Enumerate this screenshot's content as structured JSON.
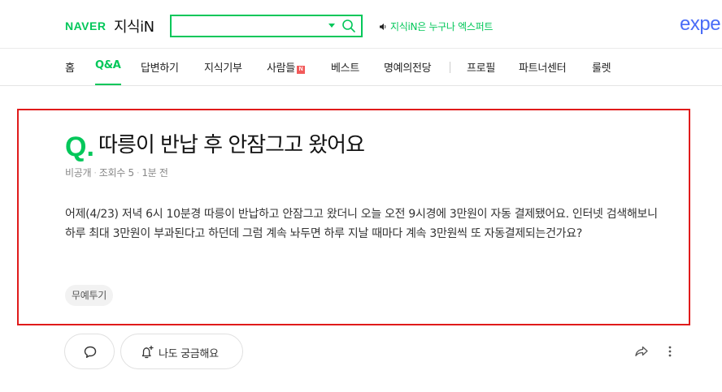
{
  "header": {
    "logo_brand": "NAVER",
    "logo_service": "지식iN",
    "search": {
      "value": "",
      "placeholder": ""
    },
    "notice": "지식iN은 누구나 엑스퍼트",
    "expert_logo": "expe"
  },
  "nav": {
    "items": [
      {
        "label": "홈"
      },
      {
        "label": "Q&A",
        "active": true
      },
      {
        "label": "답변하기"
      },
      {
        "label": "지식기부"
      },
      {
        "label": "사람들",
        "badge": "N"
      },
      {
        "label": "베스트"
      },
      {
        "label": "명예의전당"
      },
      {
        "label": "프로필"
      },
      {
        "label": "파트너센터"
      },
      {
        "label": "룰렛"
      }
    ]
  },
  "question": {
    "mark": "Q.",
    "title": "따릉이 반납 후 안잠그고 왔어요",
    "meta": {
      "author": "비공개",
      "views": "조회수 5",
      "time": "1분 전"
    },
    "body": "어제(4/23) 저녁 6시 10분경 따릉이 반납하고 안잠그고 왔더니 오늘 오전 9시경에 3만원이 자동 결제됐어요. 인터넷 검색해보니 하루 최대 3만원이 부과된다고 하던데 그럼 계속 놔두면 하루 지날 때마다 계속 3만원씩 또 자동결제되는건가요?",
    "tag": "무예투기"
  },
  "actions": {
    "curious_label": "나도 궁금해요"
  },
  "colors": {
    "brand_green": "#03c75a",
    "highlight_red": "#e01b1b",
    "expert_blue": "#4a6cf7"
  }
}
